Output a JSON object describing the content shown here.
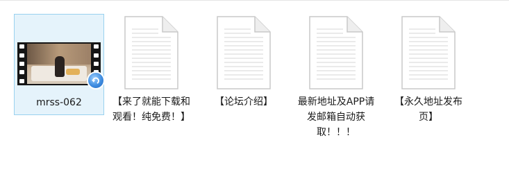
{
  "files": [
    {
      "name": "mrss-062",
      "type": "video",
      "icon": "video-thumbnail-icon",
      "selected": true
    },
    {
      "name": "【来了就能下载和观看！纯免费！】",
      "type": "text",
      "icon": "text-document-icon",
      "selected": false
    },
    {
      "name": "【论坛介绍】",
      "type": "text",
      "icon": "text-document-icon",
      "selected": false
    },
    {
      "name": "最新地址及APP请发邮箱自动获取！！！",
      "type": "text",
      "icon": "text-document-icon",
      "selected": false
    },
    {
      "name": "【永久地址发布页】",
      "type": "text",
      "icon": "text-document-icon",
      "selected": false
    }
  ],
  "colors": {
    "selection_bg": "#e5f3fb",
    "selection_border": "#99d1ef"
  }
}
